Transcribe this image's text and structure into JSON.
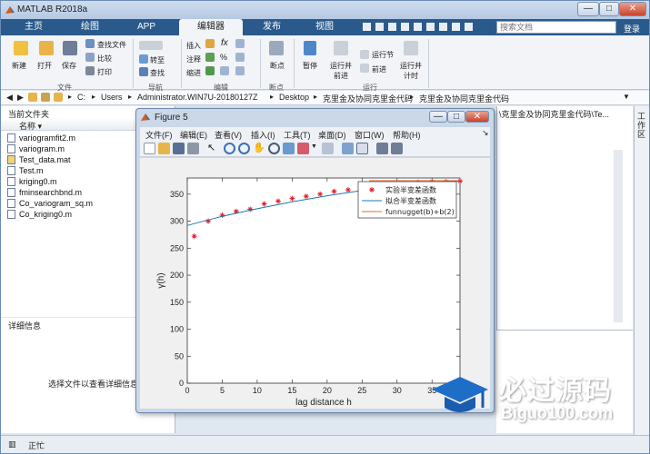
{
  "app": {
    "title": "MATLAB R2018a",
    "login": "登录"
  },
  "window_controls": {
    "minimize": "—",
    "maximize": "□",
    "close": "✕"
  },
  "tabs": [
    {
      "label": "主页"
    },
    {
      "label": "绘图"
    },
    {
      "label": "APP"
    },
    {
      "label": "编辑器"
    },
    {
      "label": "发布"
    },
    {
      "label": "视图"
    }
  ],
  "search": {
    "placeholder": "搜索文档"
  },
  "ribbon": {
    "file_group": {
      "new": "新建",
      "open": "打开",
      "save": "保存",
      "find_files": "查找文件",
      "compare": "比较",
      "print": "打印",
      "label": "文件"
    },
    "nav_group": {
      "goto": "转至",
      "find": "查找",
      "label": "导航"
    },
    "edit_group": {
      "insert": "插入",
      "comment": "注释",
      "indent": "缩进",
      "label": "编辑"
    },
    "breakpoint_group": {
      "breakpoints": "断点",
      "label": "断点"
    },
    "run_group": {
      "run": "运行",
      "run_advance": "运行并\n前进",
      "run_section": "运行节",
      "advance": "前进",
      "run_time": "运行并\n计时",
      "pause": "暂停",
      "label": "运行"
    }
  },
  "address": {
    "drive": "C:",
    "parts": [
      "Users",
      "Administrator.WIN7U-20180127Z",
      "Desktop",
      "克里金及协同克里金代码",
      "克里金及协同克里金代码"
    ],
    "separator": "▸"
  },
  "current_folder": {
    "title": "当前文件夹",
    "col_name": "名称 ▾",
    "files": [
      "variogramfit2.m",
      "variogram.m",
      "Test_data.mat",
      "Test.m",
      "kriging0.m",
      "fminsearchbnd.m",
      "Co_variogram_sq.m",
      "Co_kriging0.m"
    ]
  },
  "details": {
    "title": "详细信息",
    "placeholder": "选择文件以查看详细信息"
  },
  "status": {
    "text": "正忙"
  },
  "right_panel": {
    "label": "工作区",
    "path_fragment": "\\克里金及协同克里金代码\\Te..."
  },
  "figure": {
    "title": "Figure 5",
    "menu": [
      "文件(F)",
      "编辑(E)",
      "查看(V)",
      "插入(I)",
      "工具(T)",
      "桌面(D)",
      "窗口(W)",
      "帮助(H)"
    ]
  },
  "chart_data": {
    "type": "scatter",
    "xlabel": "lag distance h",
    "ylabel": "γ(h)",
    "xlim": [
      0,
      39
    ],
    "ylim": [
      0,
      380
    ],
    "xticks": [
      0,
      5,
      10,
      15,
      20,
      25,
      30,
      35
    ],
    "yticks": [
      0,
      50,
      100,
      150,
      200,
      250,
      300,
      350
    ],
    "legend_position": "top-right",
    "series": [
      {
        "name": "实验半变差函数",
        "kind": "marker",
        "color": "#e0202a",
        "x": [
          1,
          3,
          5,
          7,
          9,
          11,
          13,
          15,
          17,
          19,
          21,
          23,
          25,
          27,
          29,
          31,
          33,
          35,
          37,
          39
        ],
        "y": [
          272,
          300,
          311,
          318,
          322,
          332,
          337,
          342,
          346,
          350,
          355,
          358,
          361,
          366,
          369,
          370,
          372,
          373,
          373,
          374
        ]
      },
      {
        "name": "拟合半变差函数",
        "kind": "line",
        "color": "#1f77b4",
        "x": [
          0,
          5,
          10,
          15,
          20,
          25,
          30,
          35,
          39
        ],
        "y": [
          292,
          309,
          323,
          336,
          347,
          357,
          366,
          372,
          374
        ]
      },
      {
        "name": "funnugget(b)+b(2)",
        "kind": "line",
        "color": "#e8662d",
        "x": [
          26,
          39
        ],
        "y": [
          375,
          375
        ]
      }
    ]
  },
  "watermark": {
    "brand": "必过源码",
    "url": "Biguo100.com"
  }
}
